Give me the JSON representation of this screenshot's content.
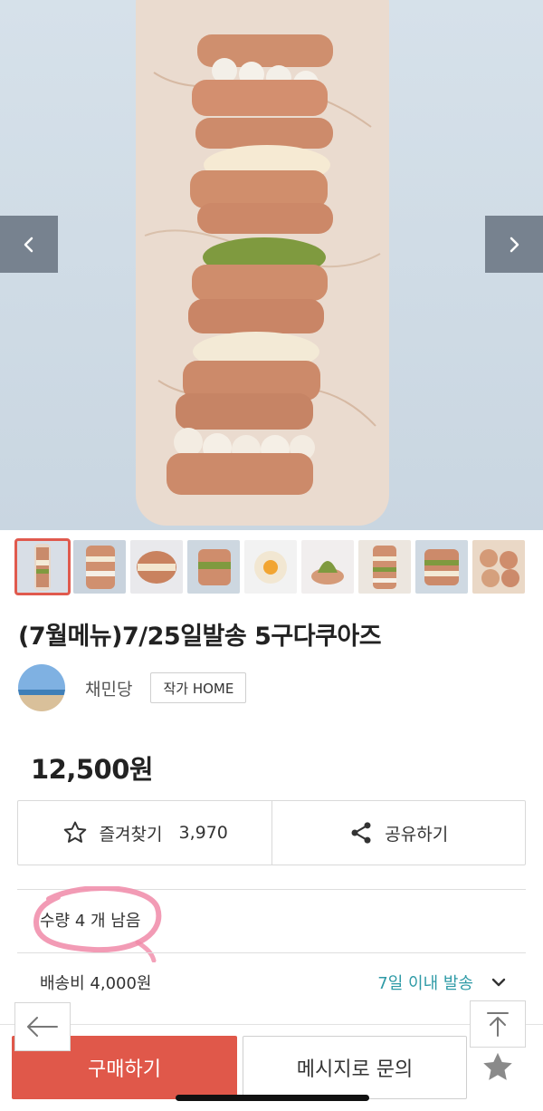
{
  "product": {
    "title": "(7월메뉴)7/25일발송 5구다쿠아즈",
    "price": "12,500원"
  },
  "gallery": {
    "thumbnail_count": 9,
    "active_index": 0
  },
  "artist": {
    "name": "채민당",
    "home_label": "작가 HOME"
  },
  "actions": {
    "favorite_label": "즐겨찾기",
    "favorite_count": "3,970",
    "share_label": "공유하기"
  },
  "stock": {
    "text": "수량 4 개 남음"
  },
  "shipping": {
    "fee": "배송비 4,000원",
    "eta": "7일 이내 발송"
  },
  "bottom_bar": {
    "buy_label": "구매하기",
    "message_label": "메시지로 문의"
  },
  "icons": {
    "prev": "chevron-left-icon",
    "next": "chevron-right-icon",
    "favorite": "star-outline-icon",
    "share": "share-icon",
    "expand": "chevron-down-icon",
    "back": "arrow-left-icon",
    "top": "arrow-up-to-top-icon",
    "wishlist": "star-filled-icon"
  },
  "colors": {
    "accent": "#e0584a",
    "eta_text": "#2e9aa6",
    "highlight_circle": "#f08aa8"
  }
}
